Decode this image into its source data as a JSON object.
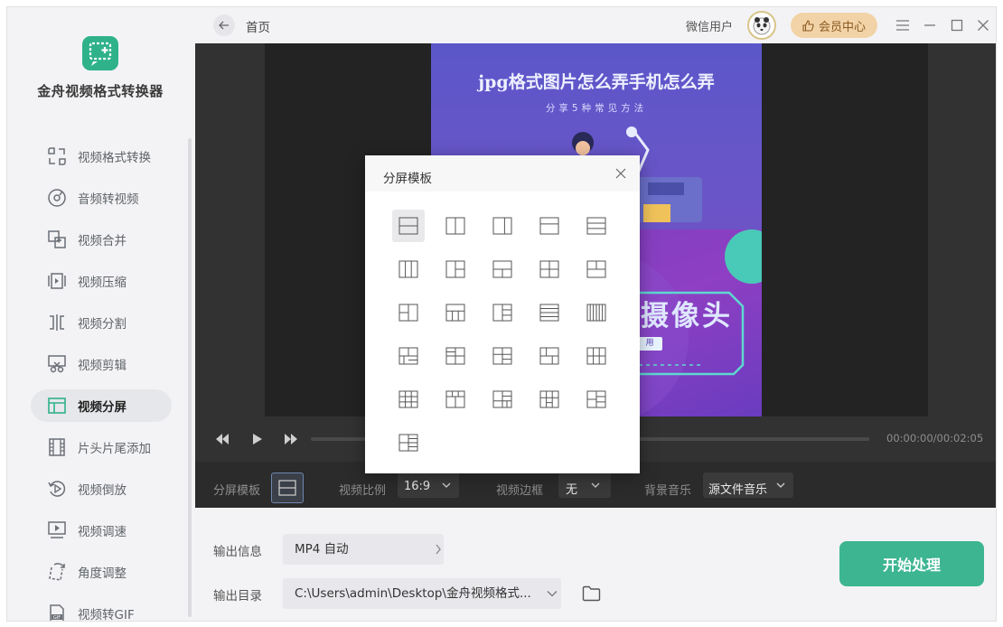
{
  "app": {
    "name": "金舟视频格式转换器",
    "accent_color": "#2fb28a",
    "logo_icon": "video-convert-logo-icon"
  },
  "topbar": {
    "breadcrumb": "首页",
    "user_name": "微信用户",
    "vip_label": "会员中心",
    "icons": [
      "back-arrow-icon",
      "avatar",
      "thumb-up-icon",
      "menu-icon",
      "minimize-icon",
      "maximize-icon",
      "close-icon"
    ]
  },
  "sidebar": {
    "active_index": 6,
    "items": [
      {
        "label": "视频格式转换",
        "icon": "format-convert-icon"
      },
      {
        "label": "音频转视频",
        "icon": "audio-disc-icon"
      },
      {
        "label": "视频合并",
        "icon": "merge-icon"
      },
      {
        "label": "视频压缩",
        "icon": "compress-icon"
      },
      {
        "label": "视频分割",
        "icon": "split-icon"
      },
      {
        "label": "视频剪辑",
        "icon": "scissors-icon"
      },
      {
        "label": "视频分屏",
        "icon": "split-screen-icon"
      },
      {
        "label": "片头片尾添加",
        "icon": "film-strip-icon"
      },
      {
        "label": "视频倒放",
        "icon": "reverse-play-icon"
      },
      {
        "label": "视频调速",
        "icon": "speed-icon"
      },
      {
        "label": "角度调整",
        "icon": "rotate-icon"
      },
      {
        "label": "视频转GIF",
        "icon": "gif-file-icon"
      }
    ]
  },
  "preview": {
    "poster_title": "jpg格式图片怎么弄手机怎么弄",
    "poster_subtitle": "分享5种常见方法",
    "poster_big_text": "摄像头",
    "poster_tag": "用"
  },
  "player": {
    "time": "00:00:00/00:02:05",
    "progress": 0.0,
    "icons": [
      "rewind-icon",
      "play-icon",
      "fast-forward-icon"
    ]
  },
  "options": {
    "layout_label": "分屏模板",
    "ratio_label": "视频比例",
    "ratio_value": "16:9",
    "border_label": "视频边框",
    "border_value": "无",
    "music_label": "背景音乐",
    "music_value": "源文件音乐"
  },
  "output": {
    "info_label": "输出信息",
    "info_value": "MP4 自动",
    "dir_label": "输出目录",
    "dir_value": "C:\\Users\\admin\\Desktop\\金舟视频格式...",
    "start_label": "开始处理"
  },
  "modal": {
    "title": "分屏模板",
    "selected_index": 0,
    "template_count": 26
  }
}
